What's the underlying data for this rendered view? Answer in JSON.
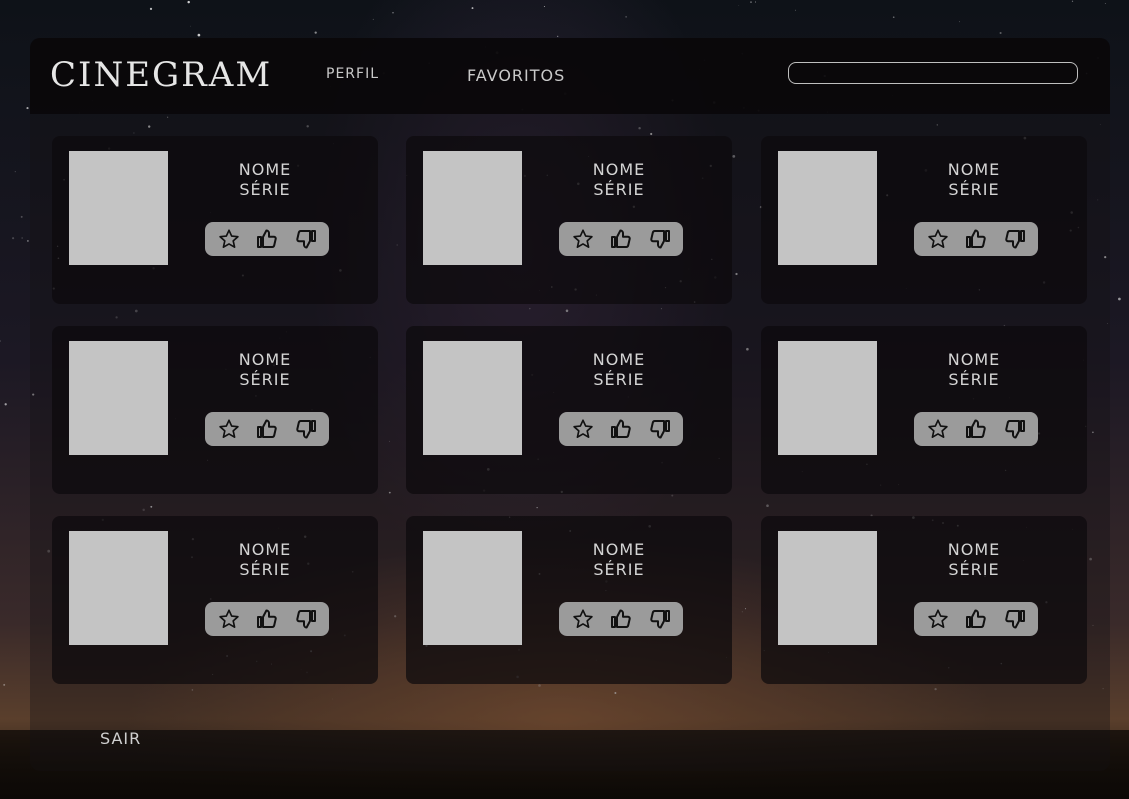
{
  "header": {
    "logo": "CINEGRAM",
    "nav": [
      {
        "label": "PERFIL"
      },
      {
        "label": "FAVORITOS"
      }
    ],
    "search": {
      "placeholder": "",
      "value": ""
    }
  },
  "cards": [
    {
      "title_line1": "NOME",
      "title_line2": "SÉRIE"
    },
    {
      "title_line1": "NOME",
      "title_line2": "SÉRIE"
    },
    {
      "title_line1": "NOME",
      "title_line2": "SÉRIE"
    },
    {
      "title_line1": "NOME",
      "title_line2": "SÉRIE"
    },
    {
      "title_line1": "NOME",
      "title_line2": "SÉRIE"
    },
    {
      "title_line1": "NOME",
      "title_line2": "SÉRIE"
    },
    {
      "title_line1": "NOME",
      "title_line2": "SÉRIE"
    },
    {
      "title_line1": "NOME",
      "title_line2": "SÉRIE"
    },
    {
      "title_line1": "NOME",
      "title_line2": "SÉRIE"
    }
  ],
  "card_icons": [
    "star-icon",
    "thumbs-up-icon",
    "thumbs-down-icon"
  ],
  "footer": {
    "logout_label": "SAIR"
  },
  "colors": {
    "poster_placeholder": "#c4c4c4",
    "action_bar": "#9b9b9b",
    "text": "#d4d4d4"
  }
}
